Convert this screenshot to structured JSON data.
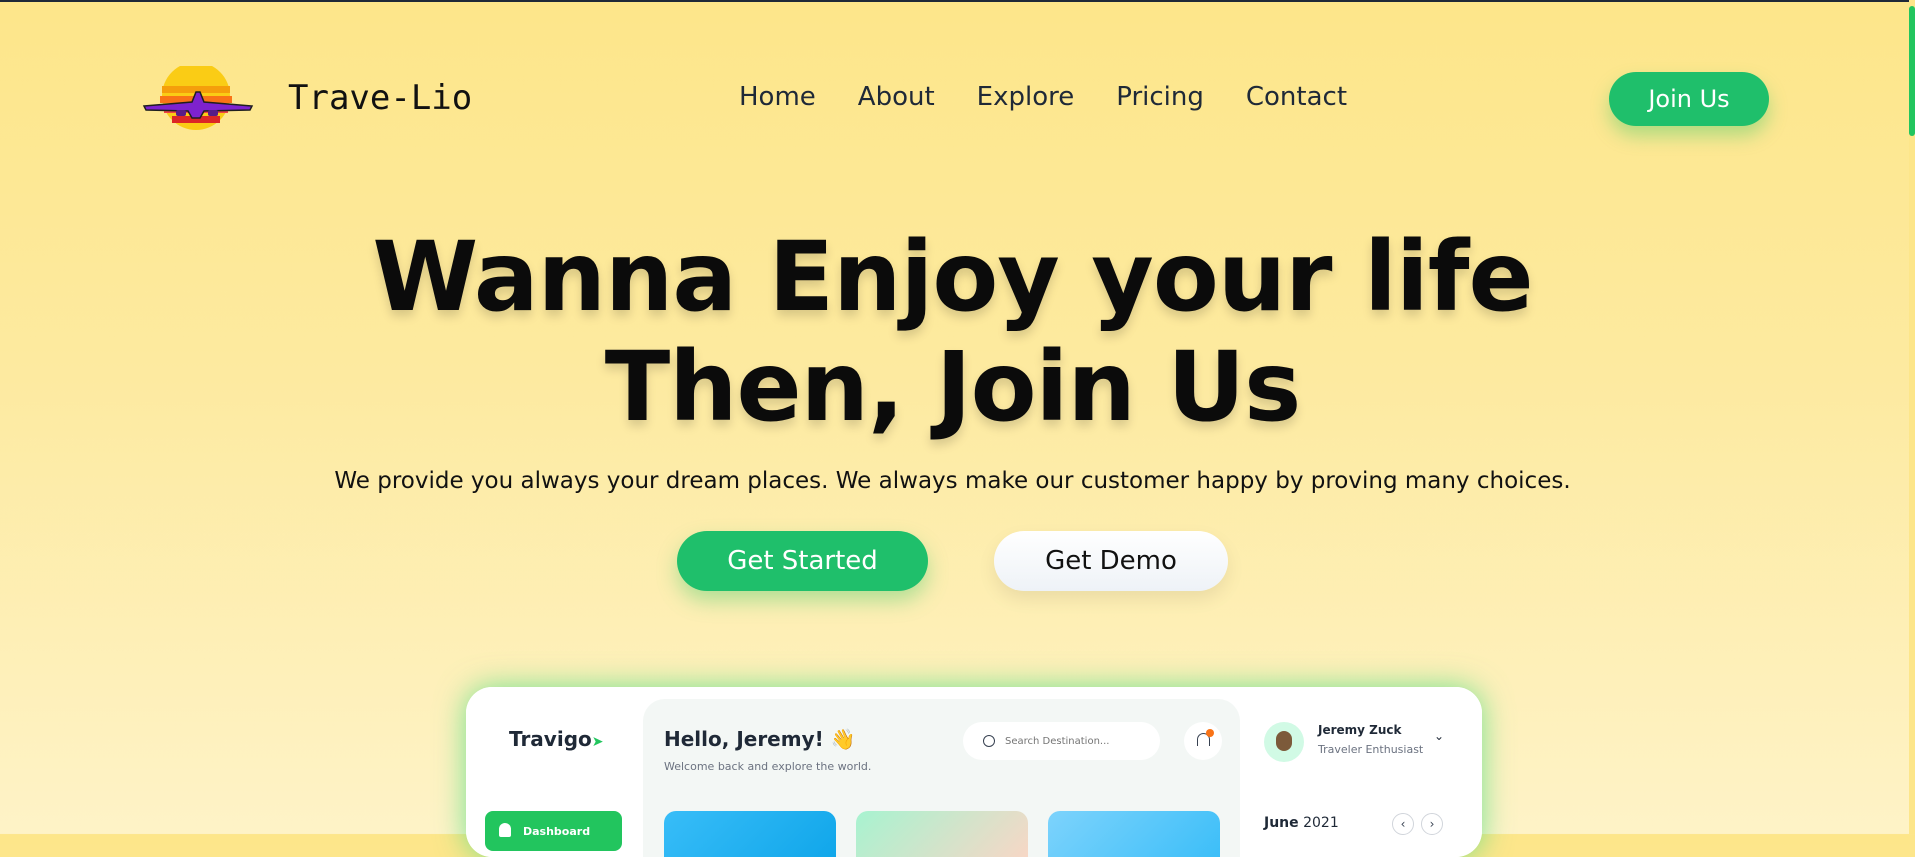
{
  "brand": {
    "name": "Trave-Lio"
  },
  "nav": {
    "items": [
      "Home",
      "About",
      "Explore",
      "Pricing",
      "Contact"
    ],
    "cta": "Join Us"
  },
  "hero": {
    "title_line1": "Wanna Enjoy your life",
    "title_line2": "Then, Join Us",
    "subtitle": "We provide you always your dream places. We always make our customer happy by proving many choices.",
    "primary_button": "Get Started",
    "secondary_button": "Get Demo"
  },
  "dashboard": {
    "brand": "Travigo",
    "menu_item": "Dashboard",
    "greeting": "Hello, Jeremy! 👋",
    "welcome": "Welcome back and explore the world.",
    "search_placeholder": "Search Destination...",
    "notification_count": "1",
    "user_name": "Jeremy Zuck",
    "user_role": "Traveler Enthusiast",
    "month": "June",
    "year": "2021"
  },
  "colors": {
    "accent": "#1fbf6b",
    "background_top": "#fde68a",
    "background_bottom": "#fef3c7"
  },
  "icons": [
    "airplane-sunset-logo",
    "search-icon",
    "bell-icon",
    "chevron-down-icon",
    "chevron-left-icon",
    "chevron-right-icon",
    "home-icon"
  ]
}
